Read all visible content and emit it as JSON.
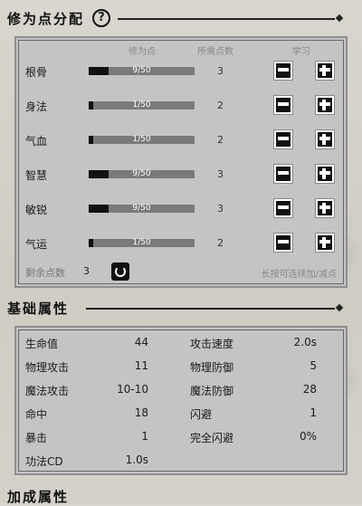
{
  "section1": {
    "title": "修为点分配"
  },
  "help_icon_glyph": "?",
  "columns": {
    "points": "修为点",
    "required": "所需点数",
    "learn": "学习"
  },
  "stats": [
    {
      "name": "根骨",
      "value": "9/50",
      "fill": 0.18,
      "required": "3"
    },
    {
      "name": "身法",
      "value": "1/50",
      "fill": 0.02,
      "required": "2"
    },
    {
      "name": "气血",
      "value": "1/50",
      "fill": 0.02,
      "required": "2"
    },
    {
      "name": "智慧",
      "value": "9/50",
      "fill": 0.18,
      "required": "3"
    },
    {
      "name": "敏锐",
      "value": "9/50",
      "fill": 0.18,
      "required": "3"
    },
    {
      "name": "气运",
      "value": "1/50",
      "fill": 0.02,
      "required": "2"
    }
  ],
  "remaining": {
    "label": "剩余点数",
    "value": "3"
  },
  "hint": "长按可连续加/减点",
  "section2": {
    "title": "基础属性"
  },
  "attributes_left": [
    {
      "name": "生命值",
      "value": "44"
    },
    {
      "name": "物理攻击",
      "value": "11"
    },
    {
      "name": "魔法攻击",
      "value": "10-10"
    },
    {
      "name": "命中",
      "value": "18"
    },
    {
      "name": "暴击",
      "value": "1"
    },
    {
      "name": "功法CD",
      "value": "1.0s"
    }
  ],
  "attributes_right": [
    {
      "name": "攻击速度",
      "value": "2.0s"
    },
    {
      "name": "物理防御",
      "value": "5"
    },
    {
      "name": "魔法防御",
      "value": "28"
    },
    {
      "name": "闪避",
      "value": "1"
    },
    {
      "name": "完全闪避",
      "value": "0%"
    }
  ],
  "section3": {
    "title": "加成属性"
  }
}
